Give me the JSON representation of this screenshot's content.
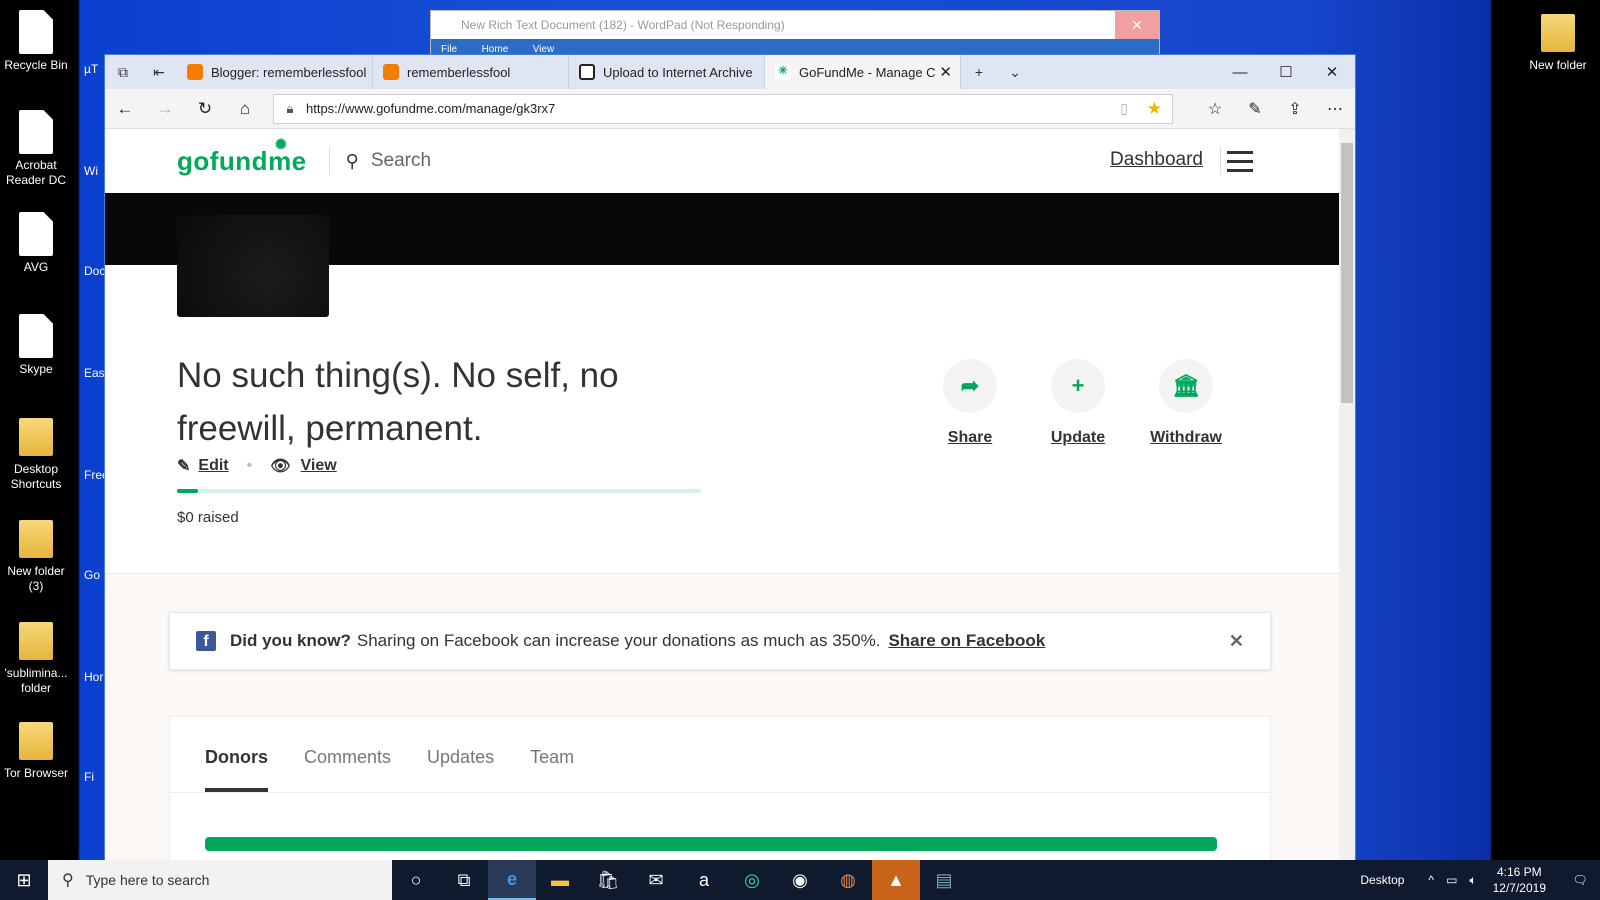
{
  "desktop": {
    "left_icons": [
      {
        "label": "Recycle Bin",
        "kind": "file"
      },
      {
        "label": "Acrobat Reader DC",
        "kind": "file"
      },
      {
        "label": "AVG",
        "kind": "file"
      },
      {
        "label": "Skype",
        "kind": "file"
      },
      {
        "label": "Desktop Shortcuts",
        "kind": "folder"
      },
      {
        "label": "New folder (3)",
        "kind": "folder"
      },
      {
        "label": "'sublimina... folder",
        "kind": "folder"
      },
      {
        "label": "Tor Browser",
        "kind": "folder"
      }
    ],
    "second_column": [
      "µT",
      "Wi",
      "Docu Sh",
      "Ease Reco",
      "Free",
      "Go Ch",
      "Horu",
      "Fi"
    ],
    "right_icon": "New folder"
  },
  "wordpad": {
    "title": "New Rich Text Document (182) - WordPad (Not Responding)",
    "ribbon": [
      "File",
      "Home",
      "View"
    ]
  },
  "browser": {
    "tabs": [
      {
        "label": "Blogger: rememberlessfool",
        "color": "#f57c00"
      },
      {
        "label": "rememberlessfool",
        "color": "#f57c00"
      },
      {
        "label": "Upload to Internet Archive",
        "color": "#222222"
      },
      {
        "label": "GoFundMe - Manage C",
        "color": "#02a95c"
      }
    ],
    "url": "https://www.gofundme.com/manage/gk3rx7"
  },
  "gofundme": {
    "logo": "gofundme",
    "search_placeholder": "Search",
    "dashboard": "Dashboard",
    "title": "No such thing(s). No self, no freewill, permanent.",
    "edit": "Edit",
    "view": "View",
    "raised": "$0 raised",
    "progress_fraction": 0.04,
    "actions": {
      "share": "Share",
      "update": "Update",
      "withdraw": "Withdraw"
    },
    "fb_notice": {
      "lead": "Did you know?",
      "text": "Sharing on Facebook can increase your donations as much as 350%.",
      "link": "Share on Facebook"
    },
    "page_tabs": [
      "Donors",
      "Comments",
      "Updates",
      "Team"
    ],
    "accent": "#02a95c"
  },
  "taskbar": {
    "search_placeholder": "Type here to search",
    "desktop_label": "Desktop",
    "time": "4:16 PM",
    "date": "12/7/2019"
  }
}
